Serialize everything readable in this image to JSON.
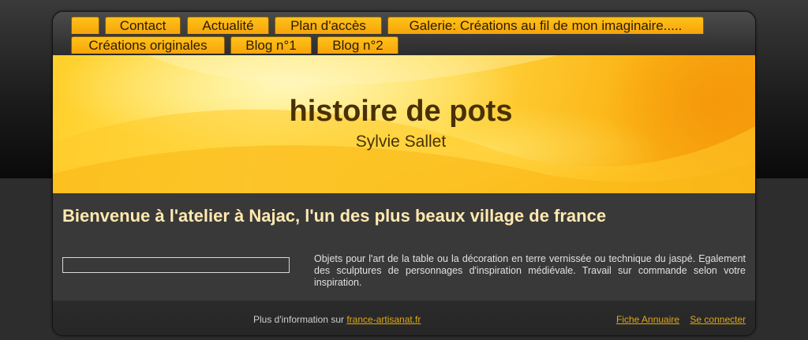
{
  "nav": {
    "tabs": [
      {
        "label": ""
      },
      {
        "label": "Contact"
      },
      {
        "label": "Actualité"
      },
      {
        "label": "Plan d'accès"
      },
      {
        "label": "Galerie: Créations au fil de mon imaginaire....."
      },
      {
        "label": "Créations originales"
      },
      {
        "label": "Blog n°1"
      },
      {
        "label": "Blog n°2"
      }
    ]
  },
  "banner": {
    "title": "histoire de pots",
    "subtitle": "Sylvie Sallet"
  },
  "content": {
    "headline": "Bienvenue à l'atelier à Najac, l'un des plus beaux village de france",
    "description": "Objets pour l'art de la table ou la décoration en terre vernissée ou technique du jaspé. Egalement des sculptures de personnages d'inspiration médiévale. Travail sur commande selon votre inspiration."
  },
  "footer": {
    "info_prefix": "Plus d'information sur ",
    "info_link": "france-artisanat.fr",
    "directory_link": "Fiche Annuaire",
    "login_link": "Se connecter"
  },
  "colors": {
    "accent": "#f7a40a",
    "headline": "#ffe9b0",
    "title": "#4a3005",
    "link": "#e0a816"
  }
}
